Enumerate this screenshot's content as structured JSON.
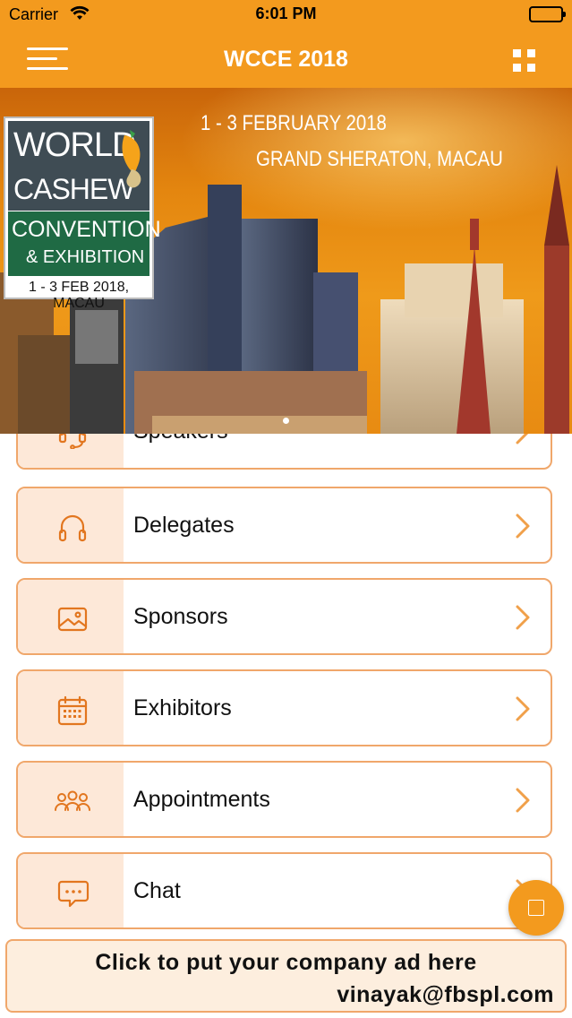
{
  "status_bar": {
    "carrier": "Carrier",
    "time": "6:01 PM",
    "wifi_icon": "wifi-icon",
    "battery_icon": "battery-icon"
  },
  "nav_bar": {
    "title": "WCCE 2018",
    "menu_icon": "hamburger-menu-icon",
    "grid_icon": "grid-icon"
  },
  "banner": {
    "logo": {
      "world": "WORLD",
      "cashew": "CASHEW",
      "convention": "CONVENTION",
      "exhibition": "& EXHIBITION",
      "date": "1 - 3 FEB 2018, MACAU"
    },
    "date_line": "1 - 3 FEBRUARY 2018",
    "venue_line": "GRAND SHERATON, MACAU"
  },
  "menu": {
    "items": [
      {
        "label": "Speakers",
        "icon": "headset-icon"
      },
      {
        "label": "Delegates",
        "icon": "headphones-icon"
      },
      {
        "label": "Sponsors",
        "icon": "image-icon"
      },
      {
        "label": "Exhibitors",
        "icon": "calendar-icon"
      },
      {
        "label": "Appointments",
        "icon": "people-icon"
      },
      {
        "label": "Chat",
        "icon": "chat-icon"
      }
    ]
  },
  "ad": {
    "line1": "Click to put your company ad here",
    "line2": "vinayak@fbspl.com"
  },
  "colors": {
    "accent": "#f39a1e",
    "icon_orange": "#e2761f",
    "item_border": "#f0a76b",
    "icon_cell_bg": "#fde8d8"
  }
}
